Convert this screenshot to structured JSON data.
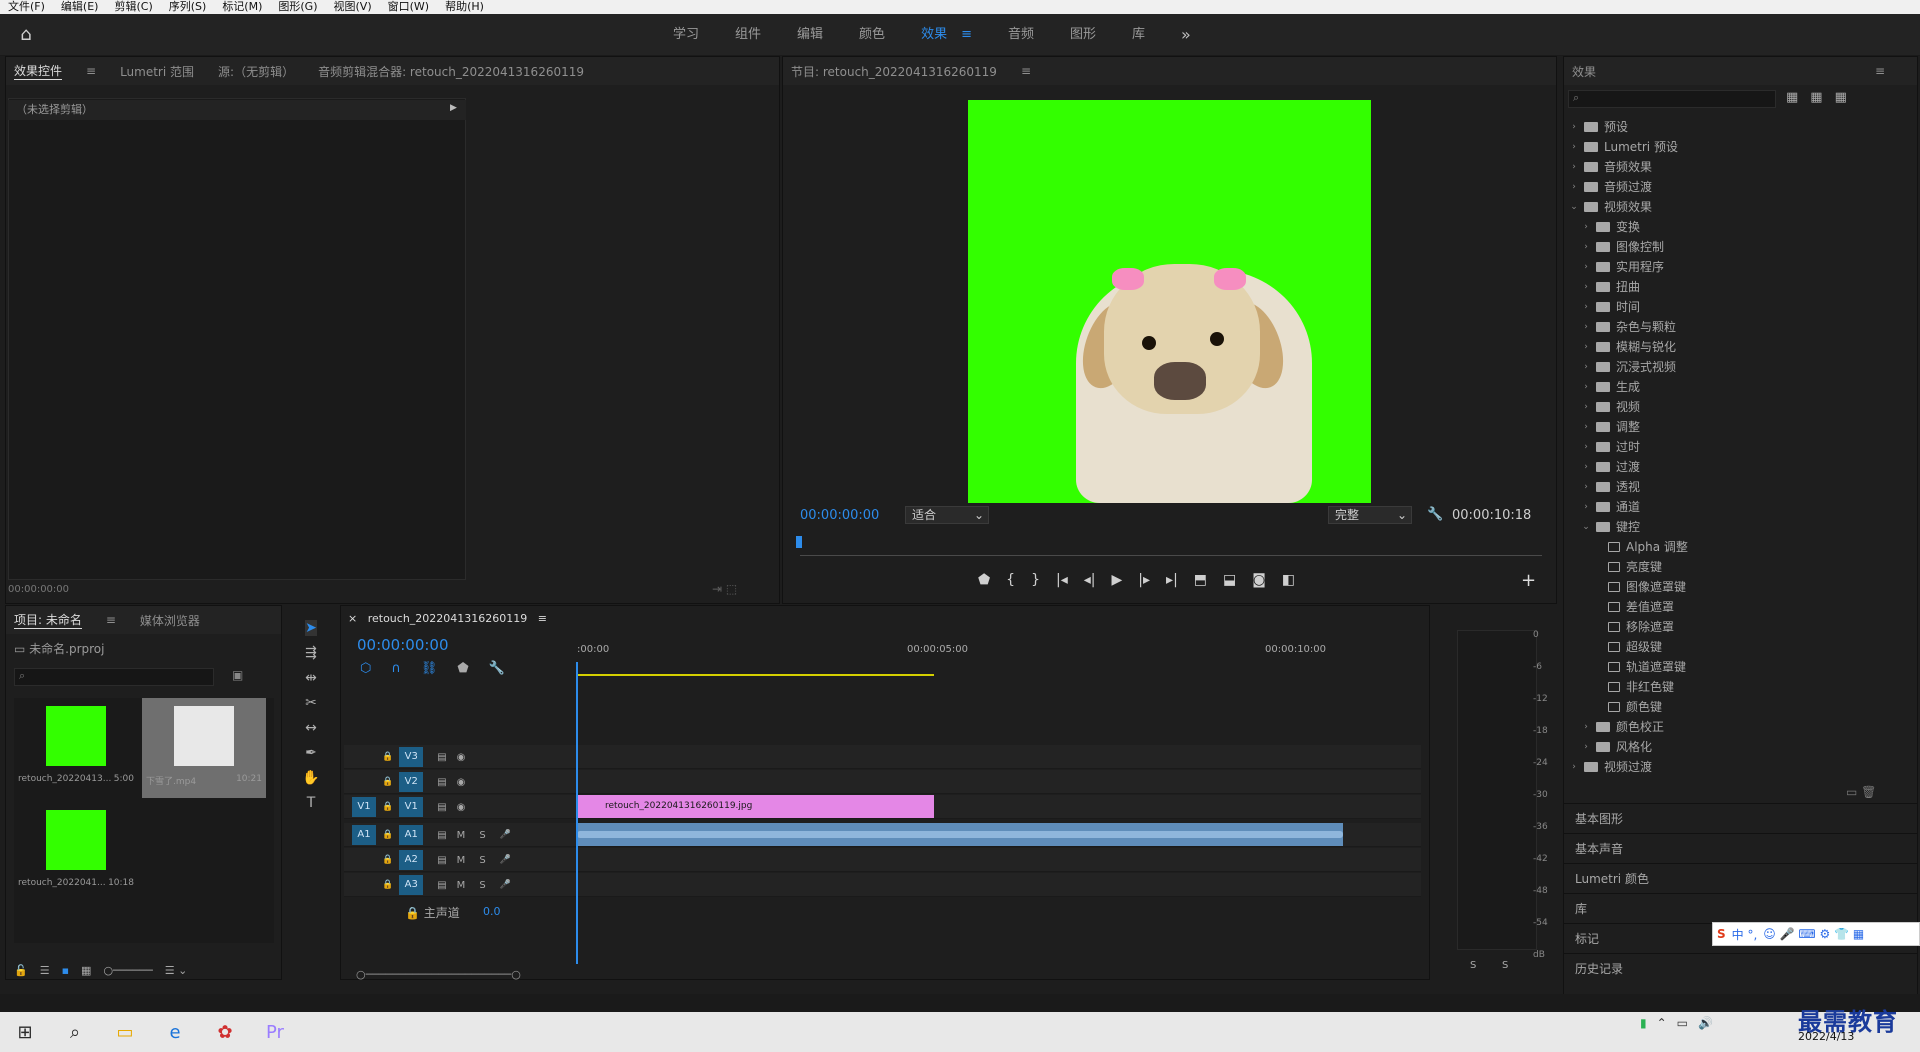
{
  "menu": [
    "文件(F)",
    "编辑(E)",
    "剪辑(C)",
    "序列(S)",
    "标记(M)",
    "图形(G)",
    "视图(V)",
    "窗口(W)",
    "帮助(H)"
  ],
  "workspaces": {
    "tabs": [
      "学习",
      "组件",
      "编辑",
      "颜色",
      "效果",
      "音频",
      "图形",
      "库"
    ],
    "active": "效果",
    "more": "»"
  },
  "effect_controls": {
    "tabs": [
      "效果控件",
      "Lumetri 范围",
      "源:（无剪辑）",
      "音频剪辑混合器: retouch_2022041316260119"
    ],
    "no_clip": "（未选择剪辑）",
    "timecode": "00:00:00:00"
  },
  "program": {
    "title": "节目: retouch_2022041316260119",
    "time_left": "00:00:00:00",
    "fit": "适合",
    "quality": "完整",
    "time_right": "00:00:10:18"
  },
  "effects": {
    "title": "效果",
    "search_placeholder": "",
    "tree": [
      {
        "label": "预设",
        "depth": 0,
        "arrow": "›",
        "icon": "preset"
      },
      {
        "label": "Lumetri 预设",
        "depth": 0,
        "arrow": "›",
        "icon": "preset"
      },
      {
        "label": "音频效果",
        "depth": 0,
        "arrow": "›",
        "icon": "folder"
      },
      {
        "label": "音频过渡",
        "depth": 0,
        "arrow": "›",
        "icon": "folder"
      },
      {
        "label": "视频效果",
        "depth": 0,
        "arrow": "⌄",
        "icon": "folder"
      },
      {
        "label": "变换",
        "depth": 1,
        "arrow": "›",
        "icon": "folder"
      },
      {
        "label": "图像控制",
        "depth": 1,
        "arrow": "›",
        "icon": "folder"
      },
      {
        "label": "实用程序",
        "depth": 1,
        "arrow": "›",
        "icon": "folder"
      },
      {
        "label": "扭曲",
        "depth": 1,
        "arrow": "›",
        "icon": "folder"
      },
      {
        "label": "时间",
        "depth": 1,
        "arrow": "›",
        "icon": "folder"
      },
      {
        "label": "杂色与颗粒",
        "depth": 1,
        "arrow": "›",
        "icon": "folder"
      },
      {
        "label": "模糊与锐化",
        "depth": 1,
        "arrow": "›",
        "icon": "folder"
      },
      {
        "label": "沉浸式视频",
        "depth": 1,
        "arrow": "›",
        "icon": "folder"
      },
      {
        "label": "生成",
        "depth": 1,
        "arrow": "›",
        "icon": "folder"
      },
      {
        "label": "视频",
        "depth": 1,
        "arrow": "›",
        "icon": "folder"
      },
      {
        "label": "调整",
        "depth": 1,
        "arrow": "›",
        "icon": "folder"
      },
      {
        "label": "过时",
        "depth": 1,
        "arrow": "›",
        "icon": "folder"
      },
      {
        "label": "过渡",
        "depth": 1,
        "arrow": "›",
        "icon": "folder"
      },
      {
        "label": "透视",
        "depth": 1,
        "arrow": "›",
        "icon": "folder"
      },
      {
        "label": "通道",
        "depth": 1,
        "arrow": "›",
        "icon": "folder"
      },
      {
        "label": "键控",
        "depth": 1,
        "arrow": "⌄",
        "icon": "folder"
      },
      {
        "label": "Alpha 调整",
        "depth": 2,
        "arrow": "",
        "icon": "fx"
      },
      {
        "label": "亮度键",
        "depth": 2,
        "arrow": "",
        "icon": "fx"
      },
      {
        "label": "图像遮罩键",
        "depth": 2,
        "arrow": "",
        "icon": "fx"
      },
      {
        "label": "差值遮罩",
        "depth": 2,
        "arrow": "",
        "icon": "fx"
      },
      {
        "label": "移除遮罩",
        "depth": 2,
        "arrow": "",
        "icon": "fx"
      },
      {
        "label": "超级键",
        "depth": 2,
        "arrow": "",
        "icon": "fx"
      },
      {
        "label": "轨道遮罩键",
        "depth": 2,
        "arrow": "",
        "icon": "fx"
      },
      {
        "label": "非红色键",
        "depth": 2,
        "arrow": "",
        "icon": "fx"
      },
      {
        "label": "颜色键",
        "depth": 2,
        "arrow": "",
        "icon": "fx"
      },
      {
        "label": "颜色校正",
        "depth": 1,
        "arrow": "›",
        "icon": "folder"
      },
      {
        "label": "风格化",
        "depth": 1,
        "arrow": "›",
        "icon": "folder"
      },
      {
        "label": "视频过渡",
        "depth": 0,
        "arrow": "›",
        "icon": "folder"
      }
    ],
    "sections": [
      "基本图形",
      "基本声音",
      "Lumetri 颜色",
      "库",
      "标记",
      "历史记录"
    ]
  },
  "project": {
    "tabs": [
      "项目: 未命名",
      "媒体浏览器"
    ],
    "file": "未命名.prproj",
    "items": [
      {
        "name": "retouch_20220413...",
        "duration": "5:00",
        "kind": "image"
      },
      {
        "name": "下雪了.mp4",
        "duration": "10:21",
        "kind": "video"
      },
      {
        "name": "retouch_2022041...",
        "duration": "10:18",
        "kind": "image"
      }
    ]
  },
  "timeline": {
    "tab": "retouch_2022041316260119",
    "timecode": "00:00:00:00",
    "ruler": [
      ":00:00",
      "00:00:05:00",
      "00:00:10:00"
    ],
    "video_tracks": [
      {
        "src": "",
        "name": "V3"
      },
      {
        "src": "",
        "name": "V2"
      },
      {
        "src": "V1",
        "name": "V1"
      }
    ],
    "audio_tracks": [
      {
        "src": "A1",
        "name": "A1"
      },
      {
        "src": "",
        "name": "A2"
      },
      {
        "src": "",
        "name": "A3"
      }
    ],
    "video_clip": "retouch_2022041316260119.jpg",
    "master_label": "主声道",
    "master_value": "0.0",
    "m_label": "M",
    "s_label": "S"
  },
  "meters": {
    "scale": [
      "0",
      "-6",
      "-12",
      "-18",
      "-24",
      "-30",
      "-36",
      "-42",
      "-48",
      "-54",
      "dB"
    ],
    "solo_l": "S",
    "solo_r": "S"
  },
  "taskbar": {
    "date": "2022/4/13",
    "brand": "最需教育",
    "ime": "中 °,"
  }
}
